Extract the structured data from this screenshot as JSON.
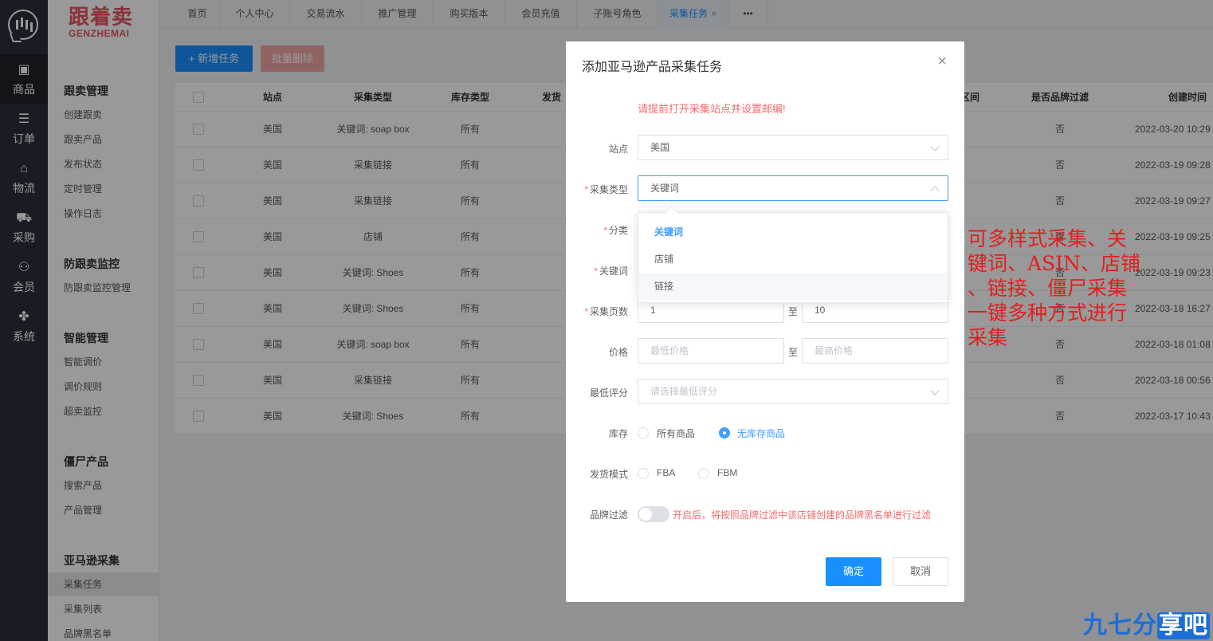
{
  "nav": {
    "items": [
      {
        "label": "商品",
        "icon": "product-icon"
      },
      {
        "label": "订单",
        "icon": "order-icon"
      },
      {
        "label": "物流",
        "icon": "logistics-icon"
      },
      {
        "label": "采购",
        "icon": "cart-icon"
      },
      {
        "label": "会员",
        "icon": "user-icon"
      },
      {
        "label": "系统",
        "icon": "puzzle-icon"
      }
    ]
  },
  "brand": {
    "cn": "跟着卖",
    "en": "GENZHEMAI"
  },
  "sidebar": {
    "groups": [
      {
        "title": "跟卖管理",
        "items": [
          "创建跟卖",
          "跟卖产品",
          "发布状态",
          "定时管理",
          "操作日志"
        ]
      },
      {
        "title": "防跟卖监控",
        "items": [
          "防跟卖监控管理"
        ]
      },
      {
        "title": "智能管理",
        "items": [
          "智能调价",
          "调价规则",
          "超卖监控"
        ]
      },
      {
        "title": "僵尸产品",
        "items": [
          "搜索产品",
          "产品管理"
        ]
      },
      {
        "title": "亚马逊采集",
        "items": [
          "采集任务",
          "采集列表",
          "品牌黑名单"
        ]
      }
    ]
  },
  "tabs": [
    "首页",
    "个人中心",
    "交易流水",
    "推广管理",
    "购买版本",
    "会员充值",
    "子账号角色",
    "采集任务",
    "•••"
  ],
  "toolbar": {
    "add_label": "+ 新增任务",
    "batch_delete_label": "批量删除"
  },
  "table": {
    "headers": [
      "站点",
      "采集类型",
      "库存类型",
      "发货",
      "区间",
      "是否品牌过滤",
      "创建时间"
    ],
    "rows": [
      {
        "site": "美国",
        "type": "关键词: soap box",
        "stock": "所有",
        "brand": "否",
        "created": "2022-03-20 10:29"
      },
      {
        "site": "美国",
        "type": "采集链接",
        "stock": "所有",
        "brand": "否",
        "created": "2022-03-19 09:28"
      },
      {
        "site": "美国",
        "type": "采集链接",
        "stock": "所有",
        "brand": "否",
        "created": "2022-03-19 09:27"
      },
      {
        "site": "美国",
        "type": "店铺",
        "stock": "所有",
        "brand": "否",
        "created": "2022-03-19 09:25"
      },
      {
        "site": "美国",
        "type": "关键词: Shoes",
        "stock": "所有",
        "brand": "否",
        "created": "2022-03-19 09:23"
      },
      {
        "site": "美国",
        "type": "关键词: Shoes",
        "stock": "所有",
        "brand": "否",
        "created": "2022-03-18 16:27"
      },
      {
        "site": "美国",
        "type": "关键词: soap box",
        "stock": "所有",
        "brand": "否",
        "created": "2022-03-18 01:08"
      },
      {
        "site": "美国",
        "type": "采集链接",
        "stock": "所有",
        "brand": "否",
        "created": "2022-03-18 00:56"
      },
      {
        "site": "美国",
        "type": "关键词: Shoes",
        "stock": "所有",
        "brand": "否",
        "created": "2022-03-17 10:43"
      }
    ]
  },
  "modal": {
    "title": "添加亚马逊产品采集任务",
    "close": "×",
    "warning": "请提前打开采集站点并设置邮编!",
    "site_label": "站点",
    "site_value": "美国",
    "type_label": "采集类型",
    "type_value": "关键词",
    "category_label": "分类",
    "keyword_label": "关键词",
    "pages_label": "采集页数",
    "pages_from": "1",
    "pages_to": "10",
    "to": "至",
    "price_label": "价格",
    "price_min_ph": "最低价格",
    "price_max_ph": "最高价格",
    "rating_label": "最低评分",
    "rating_ph": "请选择最低评分",
    "stock_label": "库存",
    "stock_options": [
      "所有商品",
      "无库存商品"
    ],
    "ship_label": "发货模式",
    "ship_options": [
      "FBA",
      "FBM"
    ],
    "brand_label": "品牌过滤",
    "brand_tip": "开启后，将按照品牌过滤中该店铺创建的品牌黑名单进行过滤",
    "ok": "确定",
    "cancel": "取消"
  },
  "dropdown": {
    "options": [
      "关键词",
      "店铺",
      "链接"
    ]
  },
  "annotation": {
    "lines": [
      "可多样式采集、关",
      "键词、ASIN、店铺",
      "、链接、僵尸采集",
      "一键多种方式进行",
      "采集"
    ]
  },
  "watermark": {
    "text1": "九七分",
    "text2": "享吧"
  }
}
